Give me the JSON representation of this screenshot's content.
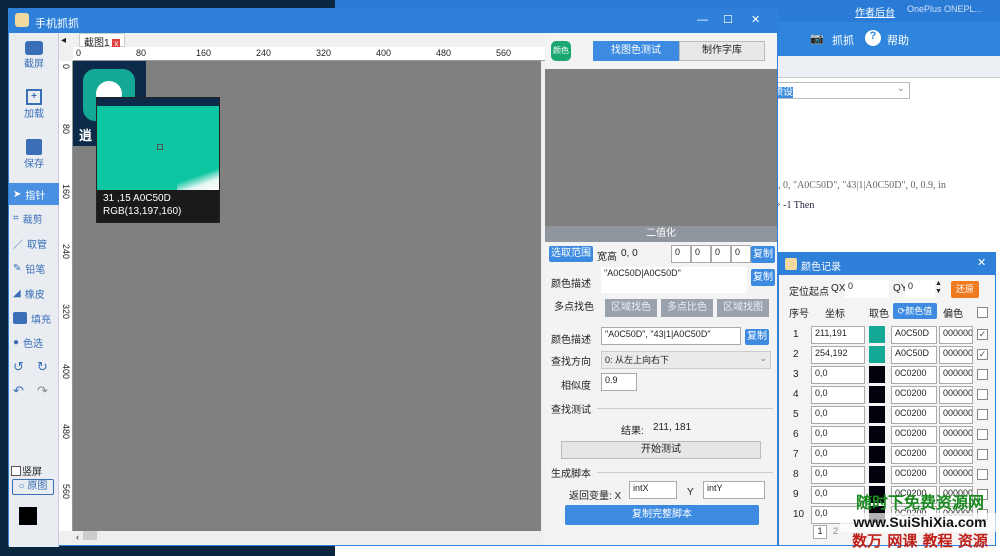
{
  "background_app": {
    "links": [
      "作者后台",
      "OnePlus ONEPL..."
    ],
    "toolbar": [
      "抓抓",
      "帮助"
    ],
    "combo_value": "预设",
    "code_lines": [
      "0, 0, \"A0C50D\", \"43|1|A0C50D\", 0, 0.9, in",
      "> -1 Then"
    ]
  },
  "main_window": {
    "title": "手机抓抓",
    "controls": [
      "—",
      "☐",
      "✕"
    ]
  },
  "left_toolbar": {
    "items": [
      "截屏",
      "加载",
      "保存",
      "指针",
      "裁剪",
      "取管",
      "铅笔",
      "橡皮",
      "填充",
      "色选"
    ],
    "active": "指针",
    "vertical_screen_label": "竖屏",
    "original_button": "原图"
  },
  "tabs": [
    {
      "label": "截图1"
    }
  ],
  "ruler": {
    "top": [
      "0",
      "80",
      "160",
      "240",
      "320",
      "400",
      "480",
      "560"
    ],
    "left": [
      "0",
      "80",
      "160",
      "240",
      "320",
      "400",
      "480",
      "560"
    ]
  },
  "magnifier": {
    "line1": "31 ,15  A0C50D",
    "line2": "RGB(13,197,160)",
    "color": "#0dc5a0"
  },
  "thumbnail_text": "逍",
  "right_panel": {
    "app_icon": "颜色",
    "tabs": [
      "找图色测试",
      "制作字库"
    ],
    "active_tab": "找图色测试",
    "binarize_header": "二值化",
    "select_range": "选取范围",
    "size_label": "宽高",
    "size_value": "0, 0",
    "range_values": [
      "0",
      "0",
      "0",
      "0"
    ],
    "copy": "复制",
    "color_desc_label": "颜色描述",
    "color_desc_value": "\"A0C50D|A0C50D\"",
    "subtabs": [
      "多点找色",
      "区域找色",
      "多点比色",
      "区域找图"
    ],
    "mp_color_desc_value": "\"A0C50D\", \"43|1|A0C50D\"",
    "direction_label": "查找方向",
    "direction_value": "0: 从左上向右下",
    "similarity_label": "相似度",
    "similarity_value": "0.9",
    "test_section": "查找测试",
    "result_label": "结果:",
    "result_value": "211, 181",
    "start_test": "开始测试",
    "script_section": "生成脚本",
    "return_var_label": "返回变量: X",
    "x_var": "intX",
    "y_label": "Y",
    "y_var": "intY",
    "copy_script": "复制完整脚本"
  },
  "color_record": {
    "title": "颜色记录",
    "origin_label": "定位起点",
    "qx_label": "QX",
    "qx_value": "0",
    "qy_label": "QY",
    "qy_value": "0",
    "restore": "还原",
    "headers": [
      "序号",
      "坐标",
      "取色",
      "颜色值",
      "偏色"
    ],
    "rows": [
      {
        "n": "1",
        "coord": "211,191",
        "swatch": "#14a896",
        "value": "A0C50D",
        "offset": "000000",
        "checked": true
      },
      {
        "n": "2",
        "coord": "254,192",
        "swatch": "#14a896",
        "value": "A0C50D",
        "offset": "000000",
        "checked": true
      },
      {
        "n": "3",
        "coord": "0,0",
        "swatch": "#02020c",
        "value": "0C0200",
        "offset": "000000",
        "checked": false
      },
      {
        "n": "4",
        "coord": "0,0",
        "swatch": "#02020c",
        "value": "0C0200",
        "offset": "000000",
        "checked": false
      },
      {
        "n": "5",
        "coord": "0,0",
        "swatch": "#02020c",
        "value": "0C0200",
        "offset": "000000",
        "checked": false
      },
      {
        "n": "6",
        "coord": "0,0",
        "swatch": "#02020c",
        "value": "0C0200",
        "offset": "000000",
        "checked": false
      },
      {
        "n": "7",
        "coord": "0,0",
        "swatch": "#02020c",
        "value": "0C0200",
        "offset": "000000",
        "checked": false
      },
      {
        "n": "8",
        "coord": "0,0",
        "swatch": "#02020c",
        "value": "0C0200",
        "offset": "000000",
        "checked": false
      },
      {
        "n": "9",
        "coord": "0,0",
        "swatch": "#02020c",
        "value": "0C0200",
        "offset": "000000",
        "checked": false
      },
      {
        "n": "10",
        "coord": "0,0",
        "swatch": "#02020c",
        "value": "0C0200",
        "offset": "000000",
        "checked": false
      }
    ],
    "pages": [
      "1",
      "2"
    ]
  },
  "watermark": {
    "line1": "随时下免费资源网",
    "line2": "www.SuiShiXia.com",
    "line3": "数万 网课 教程 资源"
  }
}
